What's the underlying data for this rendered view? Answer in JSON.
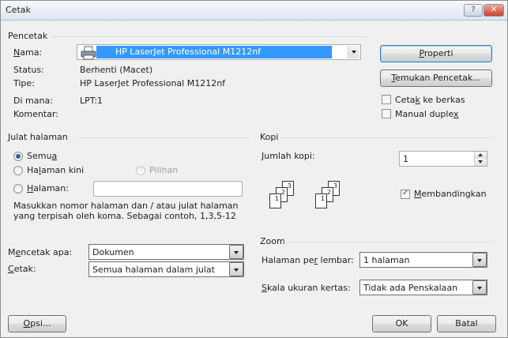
{
  "window": {
    "title": "Cetak",
    "help": "?",
    "close": "✕"
  },
  "printer": {
    "group_label": "Pencetak",
    "name_label": "Nama:",
    "name_value": "HP LaserJet Professional M1212nf",
    "status_label": "Status:",
    "status_value": "Berhenti (Macet)",
    "type_label": "Tipe:",
    "type_value": "HP LaserJet Professional M1212nf",
    "where_label": "Di mana:",
    "where_value": "LPT:1",
    "comment_label": "Komentar:",
    "properties_button": "Properti",
    "find_button": "Temukan Pencetak...",
    "print_to_file": "Cetak ke berkas",
    "print_to_file_checked": false,
    "manual_duplex": "Manual duplex",
    "manual_duplex_checked": false
  },
  "page_range": {
    "group_label": "Julat halaman",
    "all": "Semua",
    "current": "Halaman kini",
    "selection": "Pilihan",
    "pages": "Halaman:",
    "pages_value": "",
    "selected": "all",
    "hint_line1": "Masukkan nomor halaman dan / atau julat halaman",
    "hint_line2": "yang terpisah oleh koma. Sebagai contoh, 1,3,5-12"
  },
  "copies": {
    "group_label": "Kopi",
    "count_label": "Jumlah kopi:",
    "count_value": "1",
    "collate_label": "Membandingkan",
    "collate_checked": true,
    "pages": [
      "1",
      "2",
      "3"
    ]
  },
  "print_what": {
    "label": "Mencetak apa:",
    "value": "Dokumen",
    "print_label": "Cetak:",
    "print_value": "Semua halaman dalam julat"
  },
  "zoom": {
    "group_label": "Zoom",
    "pages_per_sheet_label": "Halaman per lembar:",
    "pages_per_sheet_value": "1 halaman",
    "scale_label": "Skala ukuran kertas:",
    "scale_value": "Tidak ada Penskalaan"
  },
  "footer": {
    "options": "Opsi...",
    "ok": "OK",
    "cancel": "Batal"
  },
  "icons": {
    "printer": "printer-icon",
    "dropdown": "chevron-down-icon"
  },
  "colors": {
    "selection": "#3399ff",
    "focus": "#3c7fb1"
  }
}
